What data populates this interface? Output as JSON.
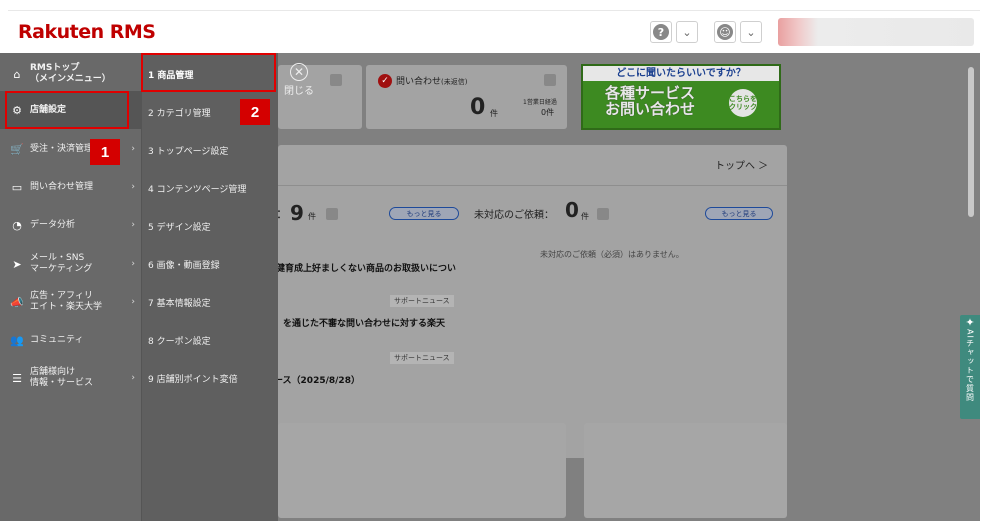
{
  "header": {
    "logo_brand": "Rakuten",
    "logo_product": "RMS",
    "help_icon_char": "?",
    "user_icon_char": "☺",
    "dropdown_char": "⌄"
  },
  "sidebar": {
    "items": [
      {
        "label": "RMSトップ\n（メインメニュー）",
        "icon": "home-icon"
      },
      {
        "label": "店舗設定",
        "icon": "gear-icon"
      },
      {
        "label": "受注・決済管理",
        "icon": "cart-icon"
      },
      {
        "label": "問い合わせ管理",
        "icon": "chat-icon"
      },
      {
        "label": "データ分析",
        "icon": "pie-chart-icon"
      },
      {
        "label": "メール・SNS\nマーケティング",
        "icon": "send-icon"
      },
      {
        "label": "広告・アフィリ\nエイト・楽天大学",
        "icon": "megaphone-icon"
      },
      {
        "label": "コミュニティ",
        "icon": "people-icon"
      },
      {
        "label": "店舗様向け\n情報・サービス",
        "icon": "info-list-icon"
      }
    ]
  },
  "submenu": {
    "items": [
      "1 商品管理",
      "2 カテゴリ管理",
      "3 トップページ設定",
      "4 コンテンツページ管理",
      "5 デザイン設定",
      "6 画像・動画登録",
      "7 基本情報設定",
      "8 クーポン設定",
      "9 店舗別ポイント変倍"
    ]
  },
  "callouts": {
    "badge1": "1",
    "badge2": "2"
  },
  "dashboard": {
    "close_label": "閉じる",
    "inquiry_label": "問い合わせ",
    "inquiry_sub_label": "(未返信)",
    "inquiry_count": "0",
    "count_unit": "件",
    "business_days_label": "1営業日経過",
    "business_days_value": "0件",
    "banner_question": "どこに聞いたらいいですか？",
    "banner_line1": "各種サービス",
    "banner_line2": "お問い合わせ",
    "banner_click": "こちらをクリック",
    "top_link": "トップへ ＞",
    "notice_colon": "：",
    "notice_count": "9",
    "more_label": "もっと見る",
    "pending_label": "未対応のご依頼：",
    "pending_count": "0",
    "pending_none": "未対応のご依頼（必須）はありません。",
    "news1": "健育成上好ましくない商品のお取扱いについ",
    "news_tag": "サポートニュース",
    "news2": "」を通じた不審な問い合わせに対する楽天",
    "news3": "ース（2025/8/28）"
  },
  "ai_chat": {
    "label": "AIチャットで質問"
  }
}
